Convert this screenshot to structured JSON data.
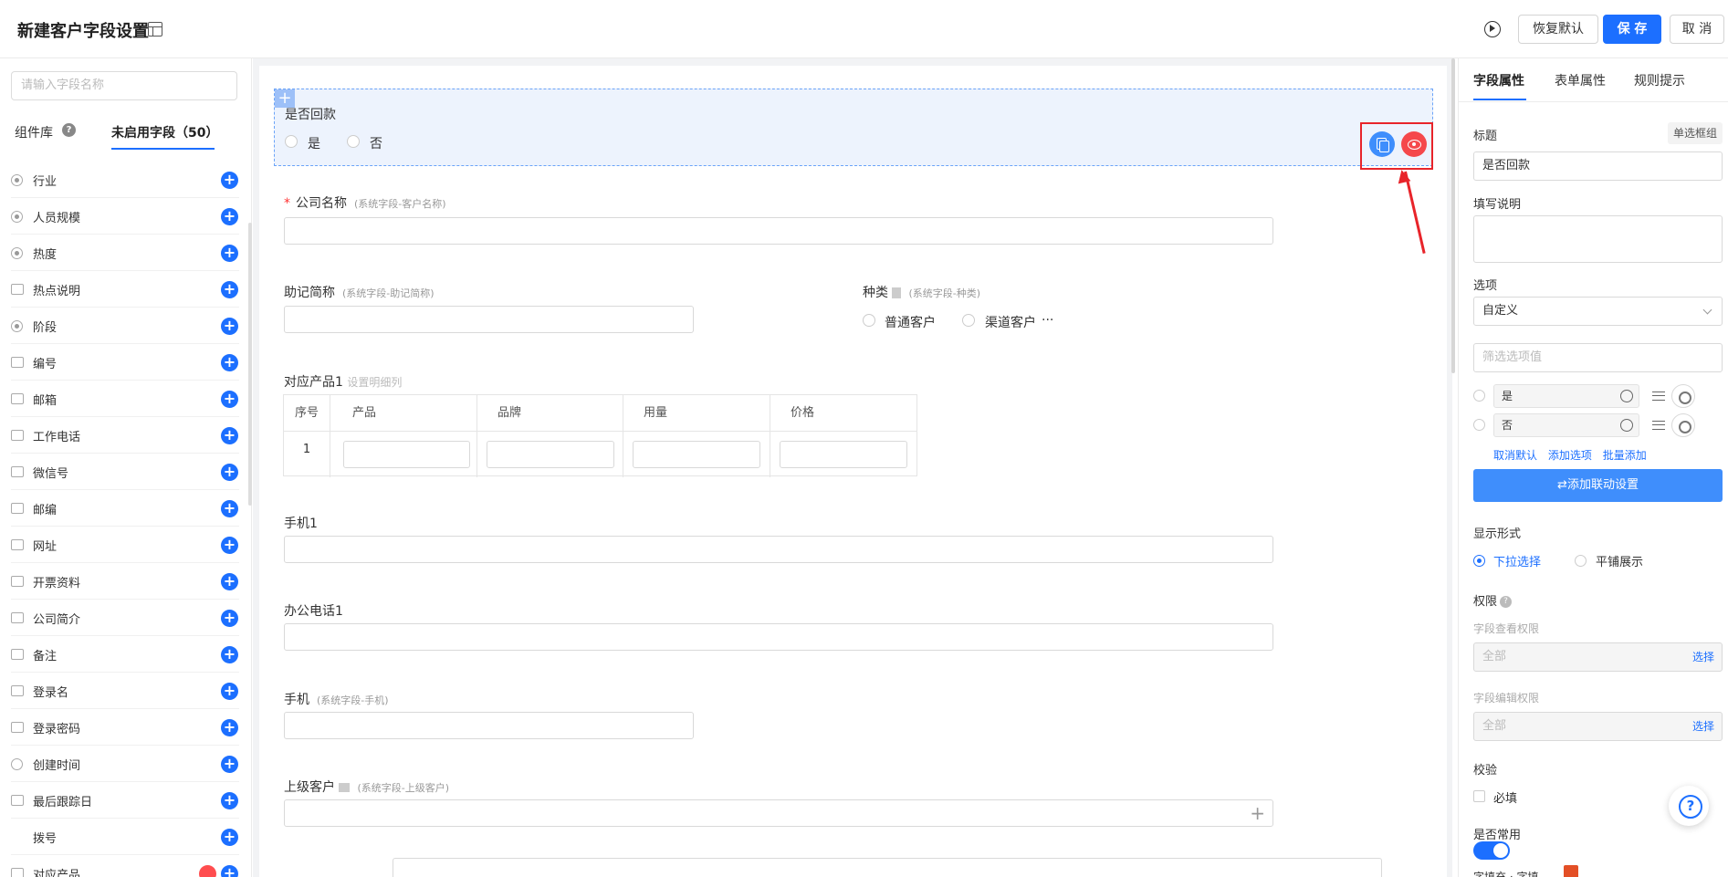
{
  "header": {
    "title": "新建客户字段设置",
    "restore_label": "恢复默认",
    "save_label": "保 存",
    "cancel_label": "取 消"
  },
  "left_panel": {
    "search_placeholder": "请输入字段名称",
    "tab_library": "组件库",
    "tab_unused": "未启用字段（50）",
    "fields": [
      {
        "name": "行业",
        "icon": "radio-icon"
      },
      {
        "name": "人员规模",
        "icon": "radio-icon"
      },
      {
        "name": "热度",
        "icon": "radio-icon"
      },
      {
        "name": "热点说明",
        "icon": "input-icon"
      },
      {
        "name": "阶段",
        "icon": "radio-icon"
      },
      {
        "name": "编号",
        "icon": "number-icon"
      },
      {
        "name": "邮箱",
        "icon": "input-icon"
      },
      {
        "name": "工作电话",
        "icon": "input-icon"
      },
      {
        "name": "微信号",
        "icon": "input-icon"
      },
      {
        "name": "邮编",
        "icon": "input-icon"
      },
      {
        "name": "网址",
        "icon": "input-icon"
      },
      {
        "name": "开票资料",
        "icon": "textarea-icon"
      },
      {
        "name": "公司简介",
        "icon": "textarea-icon"
      },
      {
        "name": "备注",
        "icon": "image-icon"
      },
      {
        "name": "登录名",
        "icon": "input-icon"
      },
      {
        "name": "登录密码",
        "icon": "input-icon"
      },
      {
        "name": "创建时间",
        "icon": "clock-icon"
      },
      {
        "name": "最后跟踪日",
        "icon": "calendar-icon"
      },
      {
        "name": "拨号",
        "icon": ""
      },
      {
        "name": "对应产品",
        "icon": "table-icon"
      }
    ]
  },
  "canvas": {
    "selected_field": {
      "label": "是否回款",
      "options": [
        "是",
        "否"
      ]
    },
    "company_name": {
      "label": "公司名称",
      "sub": "(系统字段-客户名称)",
      "required": "*"
    },
    "short_name": {
      "label": "助记简称",
      "sub": "(系统字段-助记简称)"
    },
    "category": {
      "label": "种类",
      "sub": "(系统字段-种类)",
      "options": [
        "普通客户",
        "渠道客户"
      ],
      "more": "···"
    },
    "product_table": {
      "label": "对应产品1",
      "link": "设置明细列",
      "headers": [
        "序号",
        "产品",
        "品牌",
        "用量",
        "价格"
      ],
      "row_index": "1"
    },
    "mobile1": {
      "label": "手机1"
    },
    "office_phone1": {
      "label": "办公电话1"
    },
    "mobile": {
      "label": "手机",
      "sub": "(系统字段-手机)"
    },
    "parent_customer": {
      "label": "上级客户",
      "sub": "(系统字段-上级客户)"
    }
  },
  "right_panel": {
    "tabs": [
      "字段属性",
      "表单属性",
      "规则提示"
    ],
    "title_label": "标题",
    "title_tag": "单选框组",
    "title_value": "是否回款",
    "desc_label": "填写说明",
    "options_label": "选项",
    "options_source": "自定义",
    "filter_placeholder": "筛选选项值",
    "option_values": [
      "是",
      "否"
    ],
    "links": [
      "取消默认",
      "添加选项",
      "批量添加"
    ],
    "link_button": "添加联动设置",
    "display_label": "显示形式",
    "display_options": [
      "下拉选择",
      "平铺展示"
    ],
    "perm_label": "权限",
    "view_perm_label": "字段查看权限",
    "view_perm_value": "全部",
    "edit_perm_label": "字段编辑权限",
    "edit_perm_value": "全部",
    "select_link": "选择",
    "validation_label": "校验",
    "required_label": "必填",
    "common_label": "是否常用",
    "bottom_text": "字填充 · 字填"
  },
  "colors": {
    "primary": "#1c6fff",
    "danger": "#f5484b",
    "annotation": "#e8242a"
  }
}
